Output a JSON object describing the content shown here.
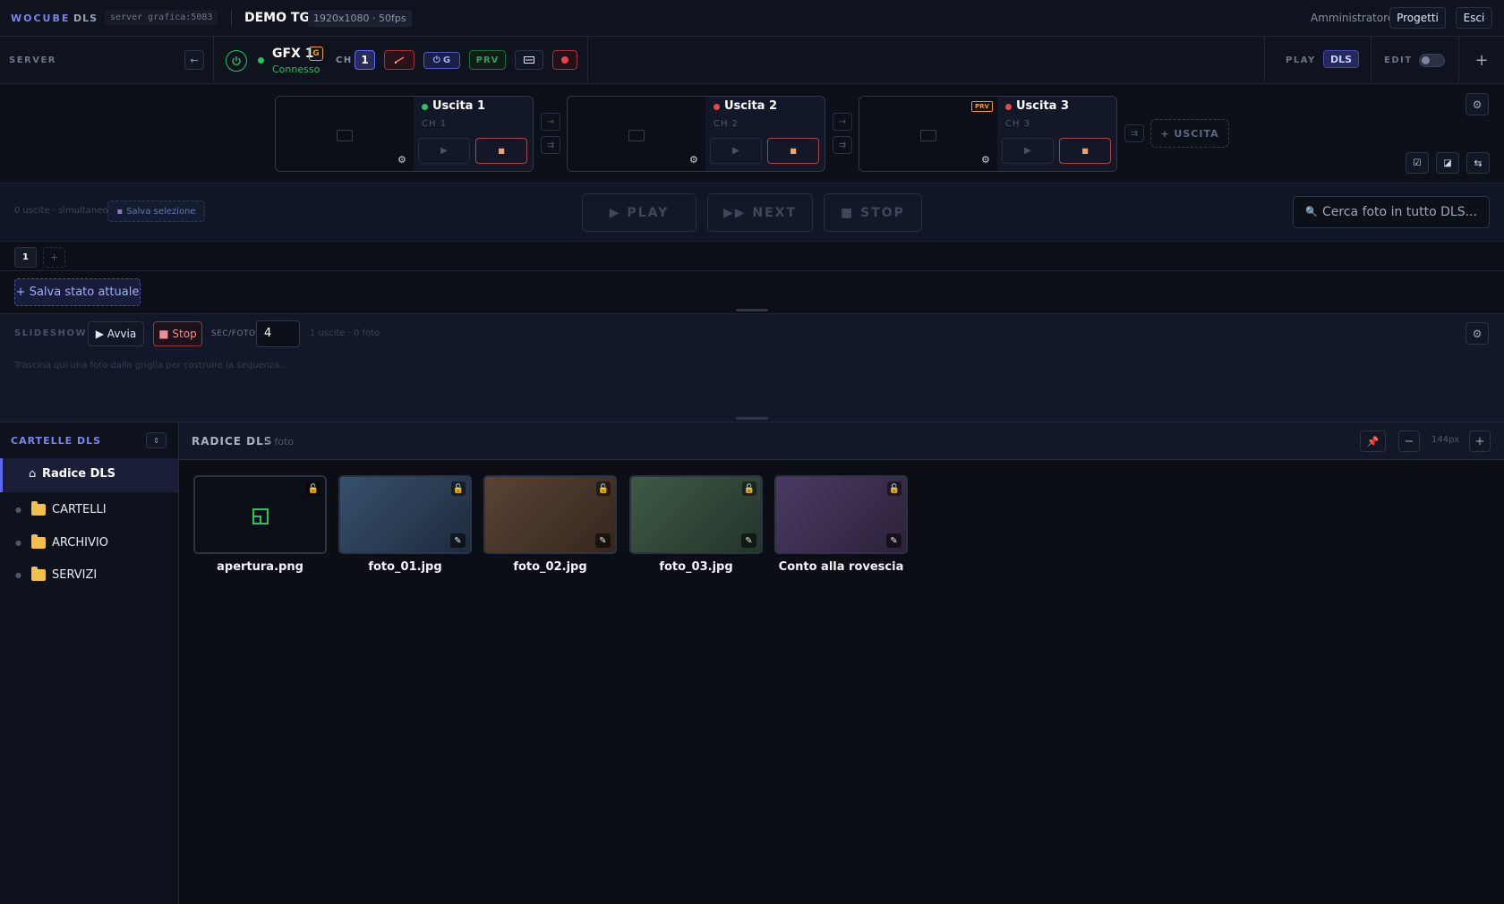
{
  "topbar": {
    "brand": "WOCUBE",
    "brand_sub": "DLS",
    "server": "server grafica:5083",
    "project": "DEMO TG",
    "resolution": "1920x1080 · 50fps",
    "user": "Amministratore",
    "projects_btn": "Progetti",
    "exit_btn": "Esci"
  },
  "toolbar": {
    "server_label": "SERVER",
    "back_icon": "←",
    "gfx_name": "GFX 1",
    "gfx_badge": "G",
    "gfx_status": "Connesso",
    "ch_label": "CH",
    "ch_value": "1",
    "g_btn": "G",
    "prv_btn": "PRV",
    "play_label": "PLAY",
    "dls_btn": "DLS",
    "edit_label": "EDIT",
    "add": "+"
  },
  "outputs": [
    {
      "name": "Uscita 1",
      "ch": "CH 1",
      "status_color": "#22c55e",
      "prv": ""
    },
    {
      "name": "Uscita 2",
      "ch": "CH 2",
      "status_color": "#ef4444",
      "prv": ""
    },
    {
      "name": "Uscita 3",
      "ch": "CH 3",
      "status_color": "#ef4444",
      "prv": "PRV"
    }
  ],
  "add_output": "+ USCITA",
  "transport": {
    "info": "0 uscite · simultaneo",
    "save_selection": "Salva selezione",
    "play": "▶ PLAY",
    "next": "▶▶ NEXT",
    "stop": "■ STOP",
    "search_placeholder": "Cerca foto in tutto DLS..."
  },
  "tabs": {
    "active": "1",
    "add": "+"
  },
  "save_state": "+ Salva stato attuale",
  "slideshow": {
    "title": "SLIDESHOW 1",
    "start": "▶ Avvia",
    "stop": "■ Stop",
    "sec_label": "SEC/FOTO",
    "sec_value": "4",
    "info": "1 uscite · 0 foto",
    "hint": "Trascina qui una foto dalla griglia per costruire la sequenza..."
  },
  "sidebar": {
    "title": "CARTELLE DLS",
    "root": "Radice DLS",
    "folders": [
      "CARTELLI",
      "ARCHIVIO",
      "SERVIZI"
    ]
  },
  "grid": {
    "title": "RADICE DLS",
    "count": "5 foto",
    "size": "144px",
    "items": [
      {
        "name": "apertura.png",
        "color": "#0c0f17"
      },
      {
        "name": "foto_01.jpg",
        "color": "#2b4058"
      },
      {
        "name": "foto_02.jpg",
        "color": "#4e3a30"
      },
      {
        "name": "foto_03.jpg",
        "color": "#34493b"
      },
      {
        "name": "Conto alla rovescia",
        "color": "#3f3252"
      }
    ]
  }
}
